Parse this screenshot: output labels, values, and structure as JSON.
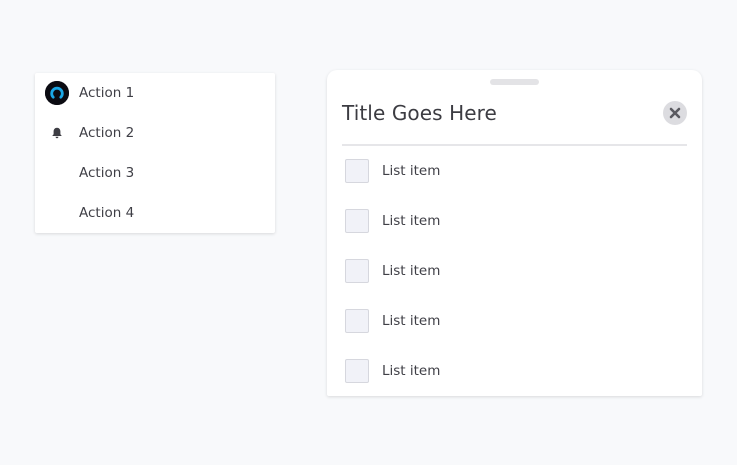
{
  "action_menu": {
    "items": [
      {
        "label": "Action 1",
        "icon": "avatar-icon"
      },
      {
        "label": "Action 2",
        "icon": "bell-icon"
      },
      {
        "label": "Action 3",
        "icon": ""
      },
      {
        "label": "Action 4",
        "icon": ""
      }
    ]
  },
  "sheet": {
    "title": "Title Goes Here",
    "close_icon": "close-icon",
    "items": [
      {
        "label": "List item"
      },
      {
        "label": "List item"
      },
      {
        "label": "List item"
      },
      {
        "label": "List item"
      },
      {
        "label": "List item"
      }
    ]
  },
  "colors": {
    "background": "#f8f9fb",
    "surface": "#ffffff",
    "avatar_ring": "#1aa7e6",
    "text": "#3f3f46",
    "checkbox_fill": "#f1f2f8"
  }
}
